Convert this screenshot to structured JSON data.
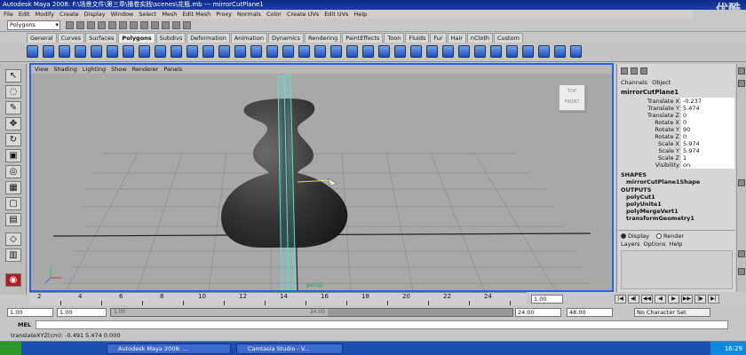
{
  "window": {
    "title": "Autodesk Maya 2008: F:\\场景文件\\第三章\\播卷实践\\scenes\\花瓶.mb  ---  mirrorCutPlane1",
    "watermark": "优酷"
  },
  "menubar": [
    "File",
    "Edit",
    "Modify",
    "Create",
    "Display",
    "Window",
    "Select",
    "Mesh",
    "Edit Mesh",
    "Proxy",
    "Normals",
    "Color",
    "Create UVs",
    "Edit UVs",
    "Help"
  ],
  "status_line": {
    "mode": "Polygons"
  },
  "shelf_tabs": [
    "General",
    "Curves",
    "Surfaces",
    "Polygons",
    "Subdivs",
    "Deformation",
    "Animation",
    "Dynamics",
    "Rendering",
    "PaintEffects",
    "Toon",
    "Fluids",
    "Fur",
    "Hair",
    "nCloth",
    "Custom"
  ],
  "shelf_active": "Polygons",
  "viewport": {
    "menu": [
      "View",
      "Shading",
      "Lighting",
      "Show",
      "Renderer",
      "Panels"
    ],
    "camera": "persp",
    "viewcube": {
      "top": "TOP",
      "front": "FRONT"
    }
  },
  "channel_box": {
    "menu": [
      "Channels",
      "Object"
    ],
    "object": "mirrorCutPlane1",
    "attributes": [
      {
        "label": "Translate X",
        "value": "-0.237"
      },
      {
        "label": "Translate Y",
        "value": "5.474"
      },
      {
        "label": "Translate Z",
        "value": "0"
      },
      {
        "label": "Rotate X",
        "value": "0"
      },
      {
        "label": "Rotate Y",
        "value": "90"
      },
      {
        "label": "Rotate Z",
        "value": "0"
      },
      {
        "label": "Scale X",
        "value": "5.974"
      },
      {
        "label": "Scale Y",
        "value": "5.974"
      },
      {
        "label": "Scale Z",
        "value": "1"
      },
      {
        "label": "Visibility",
        "value": "on"
      }
    ],
    "shapes_header": "SHAPES",
    "shapes": [
      "mirrorCutPlane1Shape"
    ],
    "outputs_header": "OUTPUTS",
    "outputs": [
      "polyCut1",
      "polyUnite1",
      "polyMergeVert1",
      "transformGeometry1"
    ]
  },
  "layer_editor": {
    "display_label": "Display",
    "render_label": "Render",
    "menu": [
      "Layers",
      "Options",
      "Help"
    ]
  },
  "timeline": {
    "ticks": [
      "2",
      "4",
      "6",
      "8",
      "10",
      "12",
      "14",
      "16",
      "18",
      "20",
      "22",
      "24"
    ],
    "current_frame": "1.00"
  },
  "range": {
    "start": "1.00",
    "playback_start": "1.00",
    "slider_left": "1.00",
    "slider_right": "24.00",
    "playback_end": "24.00",
    "end": "48.00",
    "character_set": "No Character Set"
  },
  "command_line": {
    "label": "MEL"
  },
  "help_line": {
    "text": "translateXYZ(cm):  -0.491       5.474       0.000"
  },
  "taskbar": {
    "tasks": [
      "Autodesk Maya 2008: ...",
      "Camtasia Studio - V..."
    ],
    "clock": "16:29"
  }
}
